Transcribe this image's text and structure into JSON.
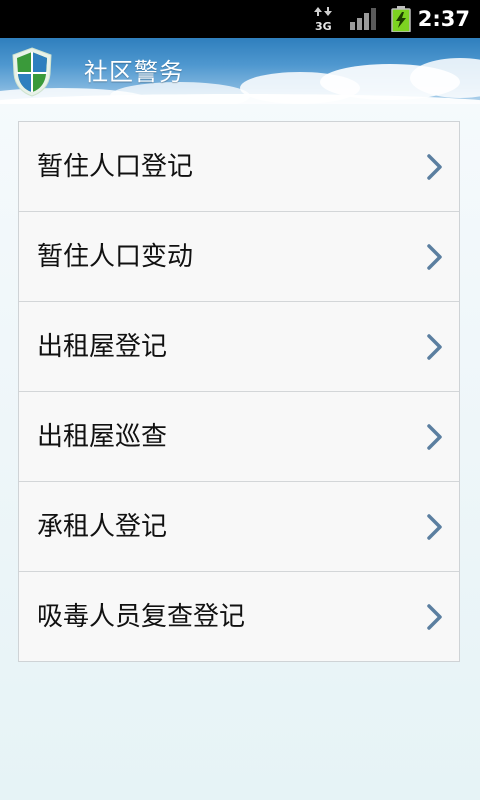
{
  "status_bar": {
    "network_label": "3G",
    "time": "2:37",
    "icons": [
      "data-3g-icon",
      "signal-strength-icon",
      "battery-charging-icon"
    ]
  },
  "header": {
    "title": "社区警务",
    "logo_icon": "shield-logo-icon"
  },
  "colors": {
    "header_blue": "#2f7fbd",
    "logo_green": "#3a9a3a",
    "chevron": "#5b7fa0",
    "battery_green": "#7dd321"
  },
  "menu": {
    "items": [
      {
        "label": "暂住人口登记"
      },
      {
        "label": "暂住人口变动"
      },
      {
        "label": "出租屋登记"
      },
      {
        "label": "出租屋巡查"
      },
      {
        "label": "承租人登记"
      },
      {
        "label": "吸毒人员复查登记"
      }
    ]
  }
}
